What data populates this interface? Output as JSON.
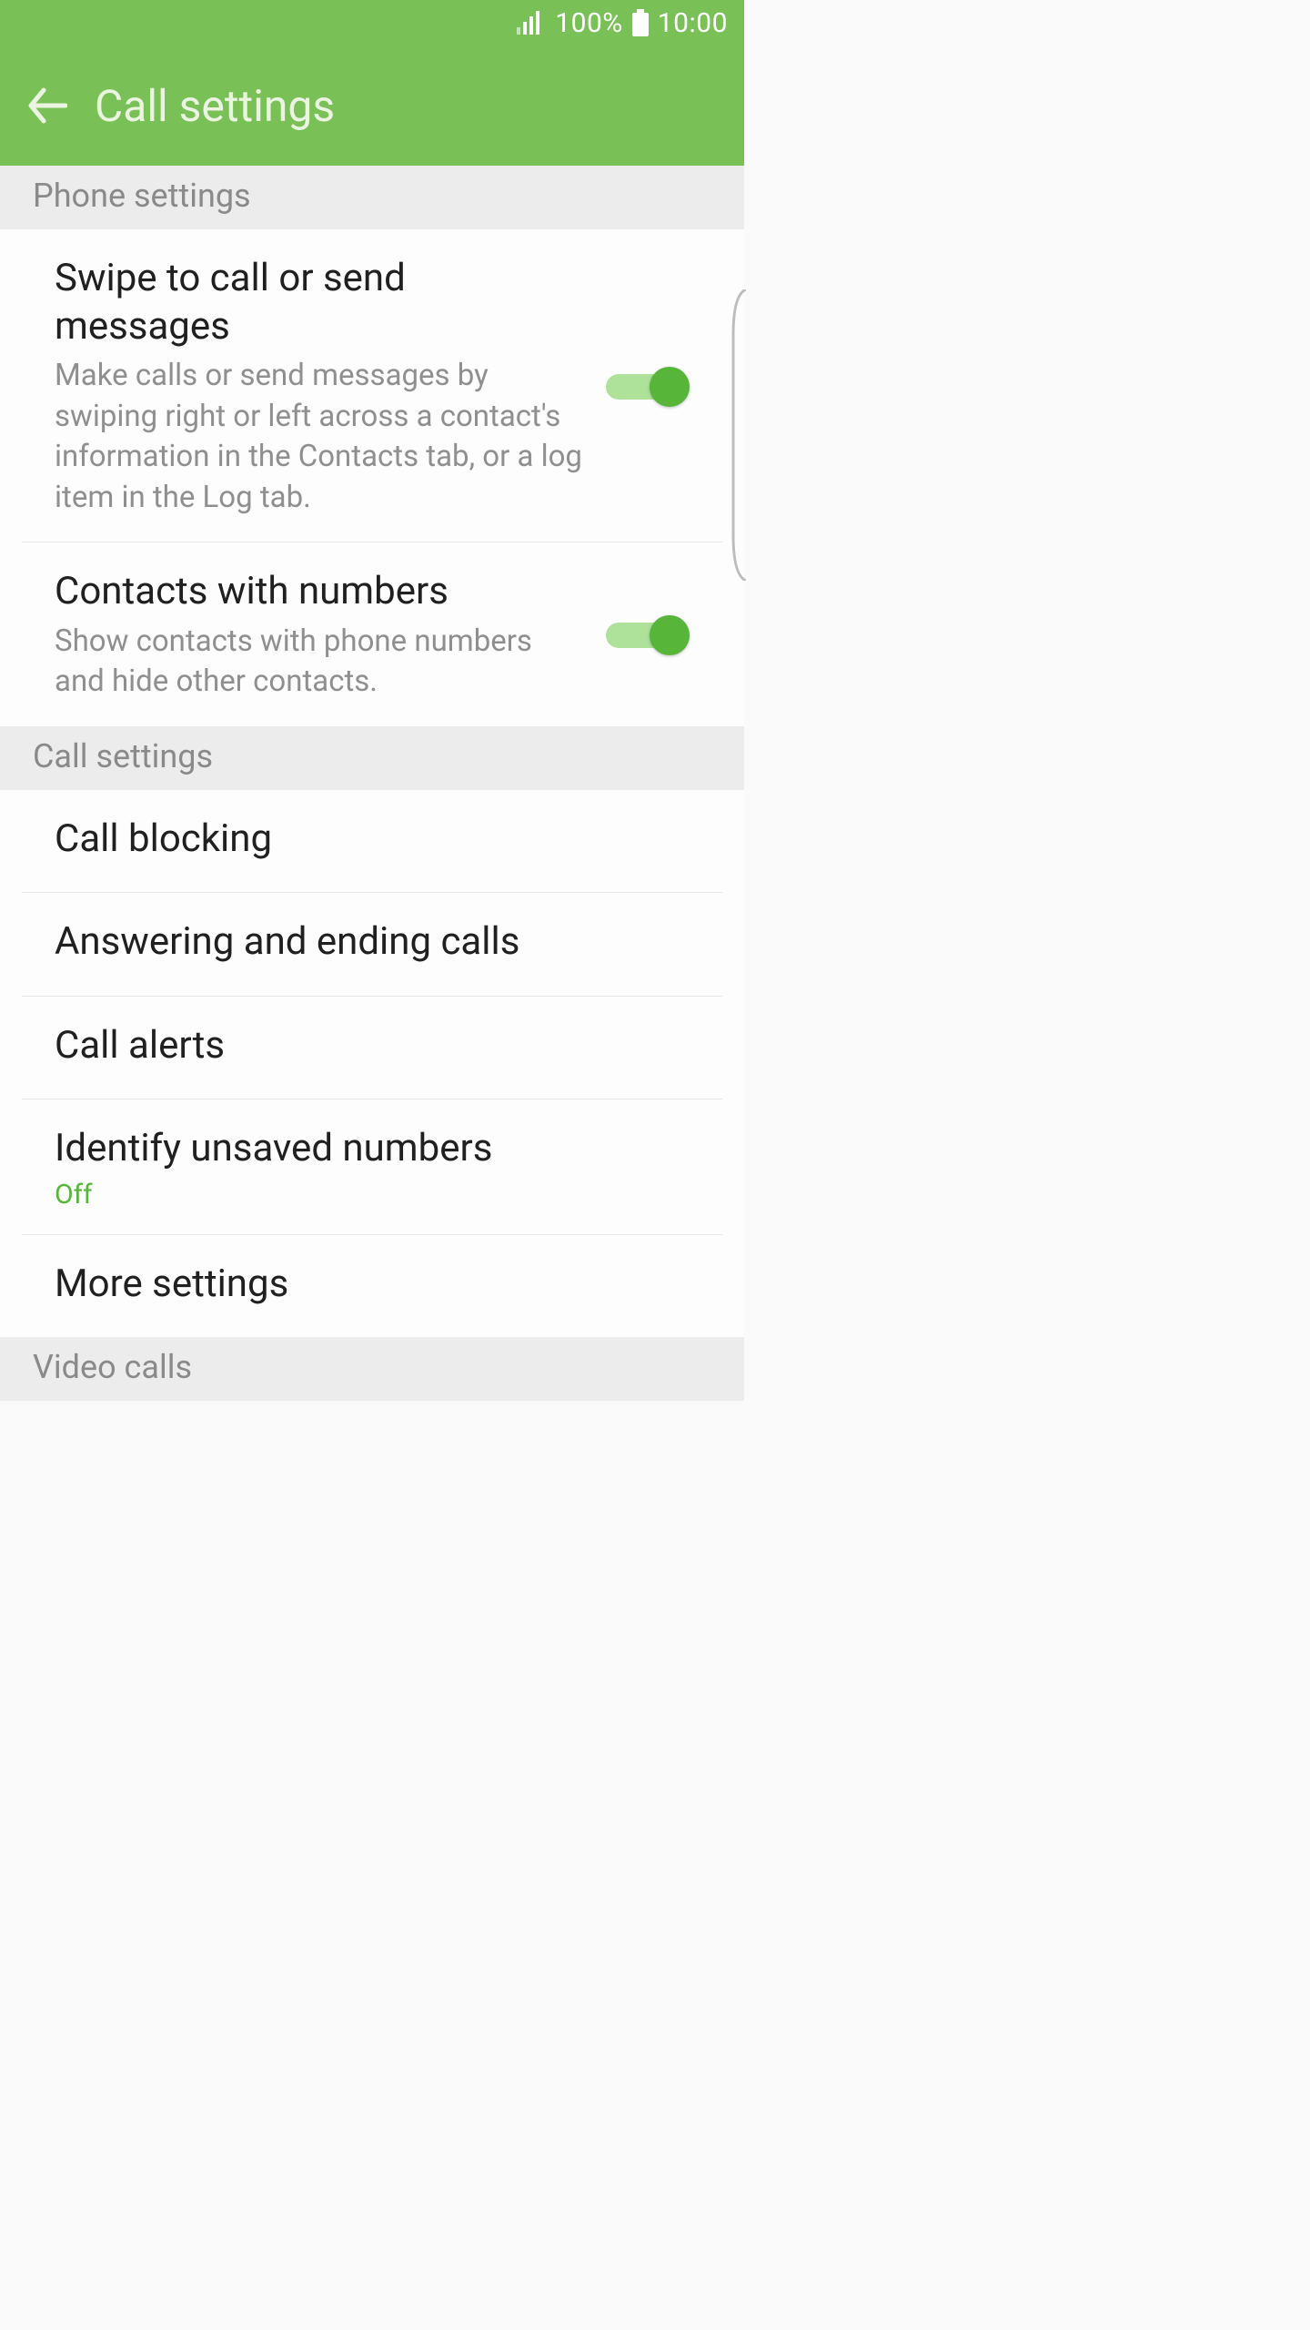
{
  "status_bar": {
    "battery": "100%",
    "time": "10:00"
  },
  "header": {
    "title": "Call settings"
  },
  "sections": [
    {
      "key": "phone_settings",
      "label": "Phone settings",
      "items": [
        {
          "key": "swipe_to_call",
          "title": "Swipe to call or send messages",
          "subtitle": "Make calls or send messages by swiping right or left across a contact's information in the Contacts tab, or a log item in the Log tab.",
          "has_toggle": true,
          "toggle_state": "on"
        },
        {
          "key": "contacts_with_numbers",
          "title": "Contacts with numbers",
          "subtitle": "Show contacts with phone numbers and hide other contacts.",
          "has_toggle": true,
          "toggle_state": "on"
        }
      ]
    },
    {
      "key": "call_settings",
      "label": "Call settings",
      "items": [
        {
          "key": "call_blocking",
          "title": "Call blocking"
        },
        {
          "key": "answering_ending",
          "title": "Answering and ending calls"
        },
        {
          "key": "call_alerts",
          "title": "Call alerts"
        },
        {
          "key": "identify_unsaved",
          "title": "Identify unsaved numbers",
          "status": "Off"
        },
        {
          "key": "more_settings",
          "title": "More settings"
        }
      ]
    },
    {
      "key": "video_calls",
      "label": "Video calls",
      "items": []
    }
  ],
  "colors": {
    "accent": "#79c057",
    "toggle_on": "#57b53a",
    "toggle_track_on": "#aee29b"
  }
}
